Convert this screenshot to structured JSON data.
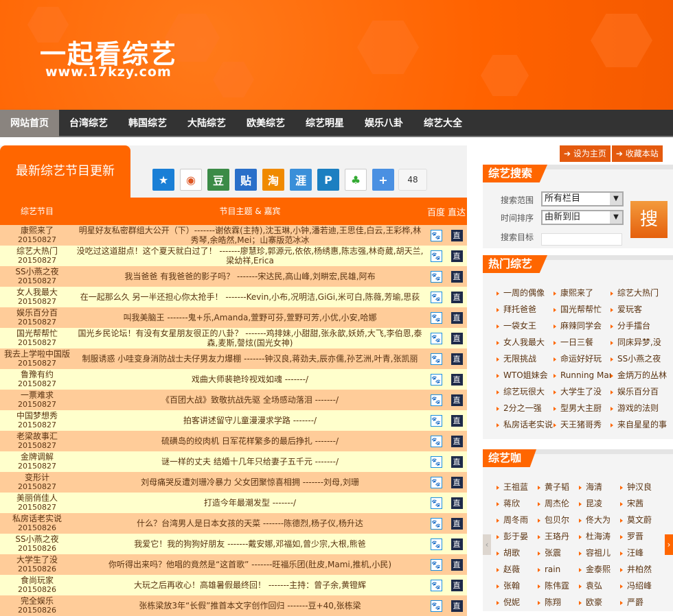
{
  "header": {
    "logo_title": "一起看综艺",
    "logo_url": "www.17kzy.com"
  },
  "nav": [
    "网站首页",
    "台湾综艺",
    "韩国综艺",
    "大陆综艺",
    "欧美综艺",
    "综艺明星",
    "娱乐八卦",
    "综艺大全"
  ],
  "latest": {
    "title": "最新综艺节目更新",
    "share_count": "48",
    "share_icons": [
      "qzone-icon",
      "weibo-icon",
      "douban-icon",
      "tieba-icon",
      "taobao-icon",
      "kaixin-icon",
      "renren-icon",
      "clover-icon",
      "more-icon"
    ],
    "columns": {
      "name": "综艺节目",
      "topic": "节目主题 & 嘉宾",
      "baidu": "百度",
      "zhida": "直达"
    },
    "rows": [
      {
        "name": "康熙来了",
        "date": "20150827",
        "topic": "明星好友私密群组大公开（下）-------谢依霖(主持),沈玉琳,小钟,潘若迪,王思佳,白云,王彩桦,林秀琴,余皓然,Mei；山寨版范冰冰"
      },
      {
        "name": "综艺大热门",
        "date": "20150827",
        "topic": "没吃过这道甜点！这个夏天就白过了！ -------廖慧珍,郭源元,依依,杨绣惠,陈志强,林奇葳,胡天兰,梁幼祥,Erica"
      },
      {
        "name": "SS小燕之夜",
        "date": "20150827",
        "topic": "我当爸爸 有我爸爸的影子吗？ -------宋达民,高山峰,刘畊宏,民雄,阿布"
      },
      {
        "name": "女人我最大",
        "date": "20150827",
        "topic": "在一起那么久 另一半还担心你太抢手！ -------Kevin,小布,况明洁,GiGi,米可白,陈薇,芳瑜,思荻"
      },
      {
        "name": "娱乐百分百",
        "date": "20150827",
        "topic": "叫我美脑王 -------鬼+乐,Amanda,萱野可芬,萱野可芳,小优,小安,哈娜"
      },
      {
        "name": "国光帮帮忙",
        "date": "20150827",
        "topic": "国光乡民论坛！有没有女星朋友很正的八卦？ -------鸡排妹,小甜甜,张永歆,妖娇,大飞,李伯恩,泰森,麦斯,謦炫(国光女神)"
      },
      {
        "name": "我去上学啦中国版",
        "date": "20150827",
        "topic": "制服诱惑 小哇变身消防战士夫仔男友力爆棚 -------钟汉良,蒋劲夫,辰亦儒,孙艺洲,叶青,张凯丽"
      },
      {
        "name": "鲁豫有约",
        "date": "20150827",
        "topic": "戏曲大师裴艳玲视戏如魂 -------/"
      },
      {
        "name": "一票难求",
        "date": "20150827",
        "topic": "《百团大战》致敬抗战先驱 全场感动落泪 -------/"
      },
      {
        "name": "中国梦想秀",
        "date": "20150827",
        "topic": "拍客讲述留守儿童漫漫求学路 -------/"
      },
      {
        "name": "老梁故事汇",
        "date": "20150827",
        "topic": "硫磺岛的绞肉机 日军花样繁多的最后挣扎 -------/"
      },
      {
        "name": "金牌调解",
        "date": "20150827",
        "topic": "谜一样的丈夫 结婚十几年只给妻子五千元 -------/"
      },
      {
        "name": "变形计",
        "date": "20150827",
        "topic": "刘母痛哭反遭刘珊冷暴力 父女团聚惊喜相拥 -------刘母,刘珊"
      },
      {
        "name": "美丽俏佳人",
        "date": "20150827",
        "topic": "打造今年最潮发型 -------/"
      },
      {
        "name": "私房话老实说",
        "date": "20150826",
        "topic": "什么？台湾男人是日本女孩的天菜 -------陈德烈,杨子仪,杨升达"
      },
      {
        "name": "SS小燕之夜",
        "date": "20150826",
        "topic": "我爱它！我的狗狗好朋友 -------戴安娜,邓福如,曾少宗,大根,熊爸"
      },
      {
        "name": "大学生了没",
        "date": "20150826",
        "topic": "你听得出来吗？他唱的竟然是“这首歌” -------旺福乐团(肚皮,Mami,推机,小民)"
      },
      {
        "name": "食尚玩家",
        "date": "20150826",
        "topic": "大玩之后再收心！高雄暑假最终回！ -------主持：曾子余,黄镫辉"
      },
      {
        "name": "完全娱乐",
        "date": "20150826",
        "topic": "张栋梁放3年“长假”推首本文字创作回归 -------豆+40,张栋梁"
      }
    ]
  },
  "top_buttons": {
    "set_home": "设为主页",
    "bookmark": "收藏本站"
  },
  "search": {
    "title": "综艺搜索",
    "scope_label": "搜索范围",
    "scope_value": "所有栏目",
    "order_label": "时间排序",
    "order_value": "由新到旧",
    "target_label": "搜索目标",
    "target_value": "",
    "button": "搜"
  },
  "hot": {
    "title": "热门综艺",
    "items": [
      "一周的偶像",
      "康熙来了",
      "综艺大热门",
      "拜托爸爸",
      "国光帮帮忙",
      "爱玩客",
      "一袋女王",
      "麻辣同学会",
      "分手擂台",
      "女人我最大",
      "一日三餐",
      "同床异梦,没",
      "无限挑战",
      "命运好好玩",
      "SS小燕之夜",
      "WTO姐妹会",
      "Running Man",
      "金炳万的丛林",
      "综艺玩很大",
      "大学生了没",
      "娱乐百分百",
      "2分之一强",
      "型男大主厨",
      "游戏的法则",
      "私房话老实说",
      "天王猪哥秀",
      "来自星星的事"
    ]
  },
  "stars": {
    "title": "综艺咖",
    "items": [
      "王祖蓝",
      "黄子韬",
      "海清",
      "钟汉良",
      "蒋欣",
      "周杰伦",
      "昆凌",
      "宋茜",
      "周冬雨",
      "包贝尔",
      "佟大为",
      "莫文蔚",
      "彭于晏",
      "王珞丹",
      "杜海涛",
      "罗晋",
      "胡歌",
      "张震",
      "容祖儿",
      "汪峰",
      "赵薇",
      "rain",
      "金泰熙",
      "井柏然",
      "张翰",
      "陈伟霆",
      "袁弘",
      "冯绍峰",
      "倪妮",
      "陈翔",
      "欧豪",
      "严爵"
    ]
  },
  "colors": {
    "brand": "#ff6600",
    "row_a": "#ffcc99",
    "row_b": "#ffffcc",
    "nav": "#333333"
  }
}
